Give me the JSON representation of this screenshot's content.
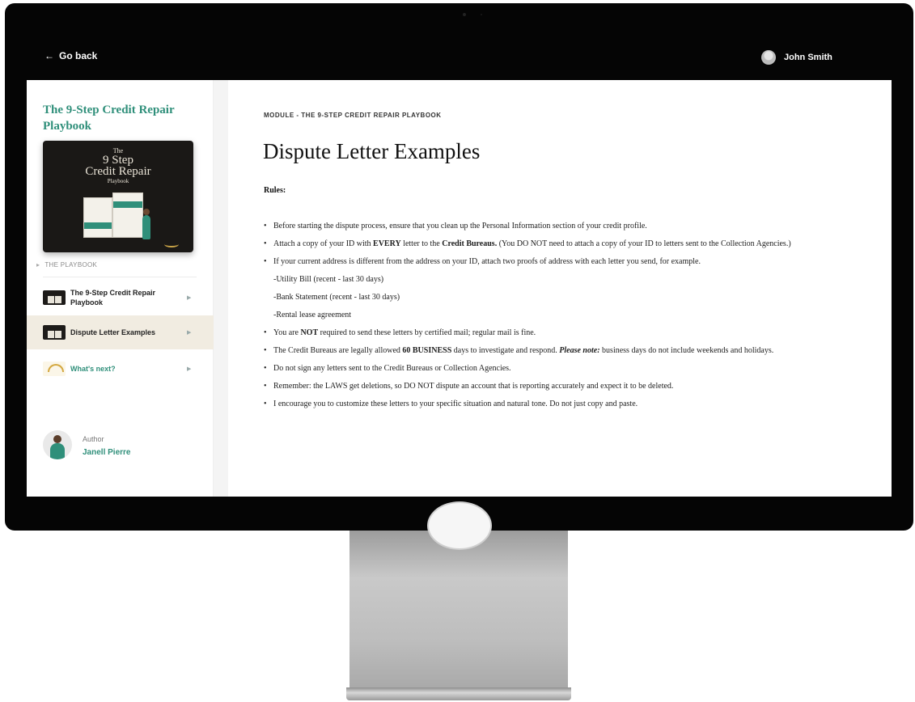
{
  "topbar": {
    "back_label": "Go back",
    "user_name": "John Smith"
  },
  "sidebar": {
    "course_title": "The 9-Step Credit Repair Playbook",
    "cover": {
      "line1": "The",
      "line2": "9 Step",
      "line3": "Credit Repair",
      "line4": "Playbook"
    },
    "section_label": "THE PLAYBOOK",
    "lessons": [
      {
        "label": "The 9-Step Credit Repair Playbook",
        "active": false
      },
      {
        "label": "Dispute Letter Examples",
        "active": true
      },
      {
        "label": "What's next?",
        "active": false
      }
    ],
    "author": {
      "role": "Author",
      "name": "Janell Pierre"
    }
  },
  "main": {
    "eyebrow": "MODULE - THE 9-STEP CREDIT REPAIR PLAYBOOK",
    "title": "Dispute Letter Examples",
    "rules_heading": "Rules:",
    "rules": [
      {
        "pre": "Before starting the dispute process, ensure that you clean up the Personal Information section of your credit profile."
      },
      {
        "pre": "Attach a copy of your ID with ",
        "b1": "EVERY",
        "mid": " letter to the ",
        "b2": "Credit Bureaus.",
        "post": " (You DO NOT need to attach a copy of your ID to letters sent to the Collection Agencies.)"
      },
      {
        "pre": "If your current address is different from the address on your ID, attach two proofs of address with each letter you send, for example."
      },
      {
        "sub": "-Utility Bill (recent - last 30 days)"
      },
      {
        "sub": "-Bank Statement (recent - last 30 days)"
      },
      {
        "sub": "-Rental lease agreement"
      },
      {
        "pre": "You are ",
        "b1": "NOT",
        "post": " required to send these letters by certified mail; regular mail is fine."
      },
      {
        "pre": " The Credit Bureaus are legally allowed ",
        "b1": "60 BUSINESS",
        "mid": " days to investigate and respond. ",
        "bi": "Please note:",
        "post": " business days do not include weekends and holidays."
      },
      {
        "pre": "Do not sign any letters sent to the Credit Bureaus or Collection Agencies."
      },
      {
        "pre": " Remember: the LAWS get deletions, so DO NOT dispute an account that is reporting accurately and expect it to be deleted."
      },
      {
        "pre": "I encourage you to customize these letters to your specific situation and natural tone. Do not just copy and paste."
      }
    ]
  },
  "colors": {
    "accent": "#2f8f7a",
    "active_row": "#f1ece1",
    "bezel": "#050505"
  }
}
